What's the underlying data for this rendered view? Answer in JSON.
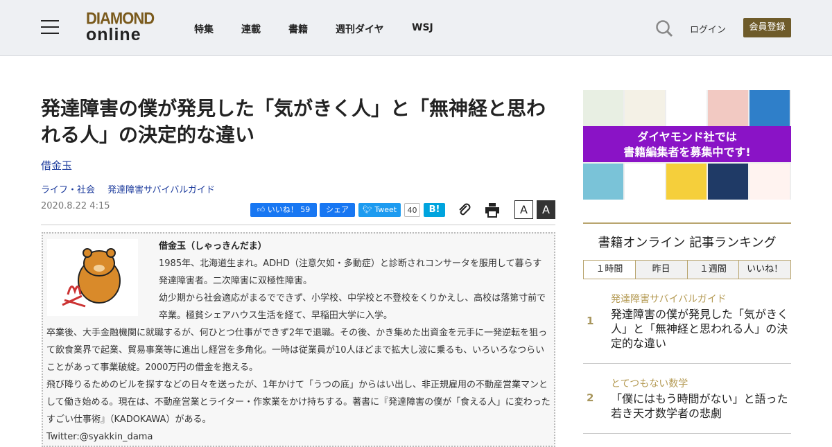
{
  "header": {
    "logo_top": "DIAMOND",
    "logo_bottom": "online",
    "nav": [
      "特集",
      "連載",
      "書籍",
      "週刊ダイヤ",
      "WSJ"
    ],
    "login": "ログイン",
    "register": "会員登録"
  },
  "article": {
    "title": "発達障害の僕が発見した「気がきく人」と「無神経と思われる人」の決定的な違い",
    "author": "借金玉",
    "categories": [
      "ライフ・社会",
      "発達障害サバイバルガイド"
    ],
    "date": "2020.8.22 4:15",
    "share": {
      "like": "いいね！",
      "like_count": "59",
      "share": "シェア",
      "tweet": "Tweet",
      "tweet_count": "40",
      "hatena": "B!",
      "font_small": "A",
      "font_large": "A"
    }
  },
  "bio": {
    "name": "借金玉（しゃっきんだま）",
    "paragraphs": [
      "1985年、北海道生まれ。ADHD（注意欠如・多動症）と診断されコンサータを服用して暮らす発達障害者。二次障害に双極性障害。",
      "幼少期から社会適応がまるでできず、小学校、中学校と不登校をくりかえし、高校は落第寸前で卒業。極貧シェアハウス生活を経て、早稲田大学に入学。",
      "卒業後、大手金融機関に就職するが、何ひとつ仕事ができず2年で退職。その後、かき集めた出資金を元手に一発逆転を狙って飲食業界で起業、貿易事業等に進出し経営を多角化。一時は従業員が10人ほどまで拡大し波に乗るも、いろいろなつらいことがあって事業破綻。2000万円の借金を抱える。",
      "飛び降りるためのビルを探すなどの日々を送ったが、1年かけて「うつの底」からはい出し、非正規雇用の不動産営業マンとして働き始める。現在は、不動産営業とライター・作家業をかけ持ちする。著書に『発達障害の僕が「食える人」に変わったすごい仕事術』（KADOKAWA）がある。",
      "Twitter:@syakkin_dama"
    ]
  },
  "sidebar": {
    "banner_text": [
      "ダイヤモンド社では",
      "書籍編集者を募集中です!"
    ],
    "ranking": {
      "title": "書籍オンライン 記事ランキング",
      "tabs": [
        "１時間",
        "昨日",
        "１週間",
        "いいね！"
      ],
      "items": [
        {
          "rank": "1",
          "category": "発達障害サバイバルガイド",
          "title": "発達障害の僕が発見した「気がきく人」と「無神経と思われる人」の決定的な違い"
        },
        {
          "rank": "2",
          "category": "とてつもない数学",
          "title": "「僕にはもう時間がない」と語った若き天才数学者の悲劇"
        }
      ]
    }
  },
  "colors": {
    "accent": "#6e5b2a",
    "link": "#1b3a9c",
    "facebook": "#1877f2",
    "twitter": "#1da1f2",
    "banner": "#8a13c6"
  }
}
